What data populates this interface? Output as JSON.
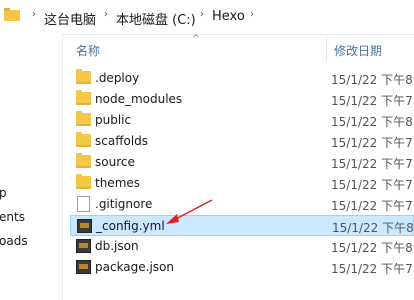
{
  "breadcrumb": [
    "这台电脑",
    "本地磁盘 (C:)",
    "Hexo"
  ],
  "nav": [
    "p",
    "ents",
    "oads"
  ],
  "columns": {
    "name": "名称",
    "modified": "修改日期"
  },
  "files": [
    {
      "name": ".deploy",
      "type": "folder",
      "date": "15/1/22 下午8"
    },
    {
      "name": "node_modules",
      "type": "folder",
      "date": "15/1/22 下午7"
    },
    {
      "name": "public",
      "type": "folder",
      "date": "15/1/22 下午8"
    },
    {
      "name": "scaffolds",
      "type": "folder",
      "date": "15/1/22 下午7"
    },
    {
      "name": "source",
      "type": "folder",
      "date": "15/1/22 下午7"
    },
    {
      "name": "themes",
      "type": "folder",
      "date": "15/1/22 下午7"
    },
    {
      "name": ".gitignore",
      "type": "file",
      "date": "15/1/22 下午7"
    },
    {
      "name": "_config.yml",
      "type": "yml",
      "date": "15/1/22 下午8",
      "selected": true
    },
    {
      "name": "db.json",
      "type": "yml",
      "date": "15/1/22 下午8"
    },
    {
      "name": "package.json",
      "type": "yml",
      "date": "15/1/22 下午7"
    }
  ],
  "colors": {
    "selection": "#cce8ff",
    "folder": "#f5c748",
    "annotation_arrow": "#e02020"
  }
}
